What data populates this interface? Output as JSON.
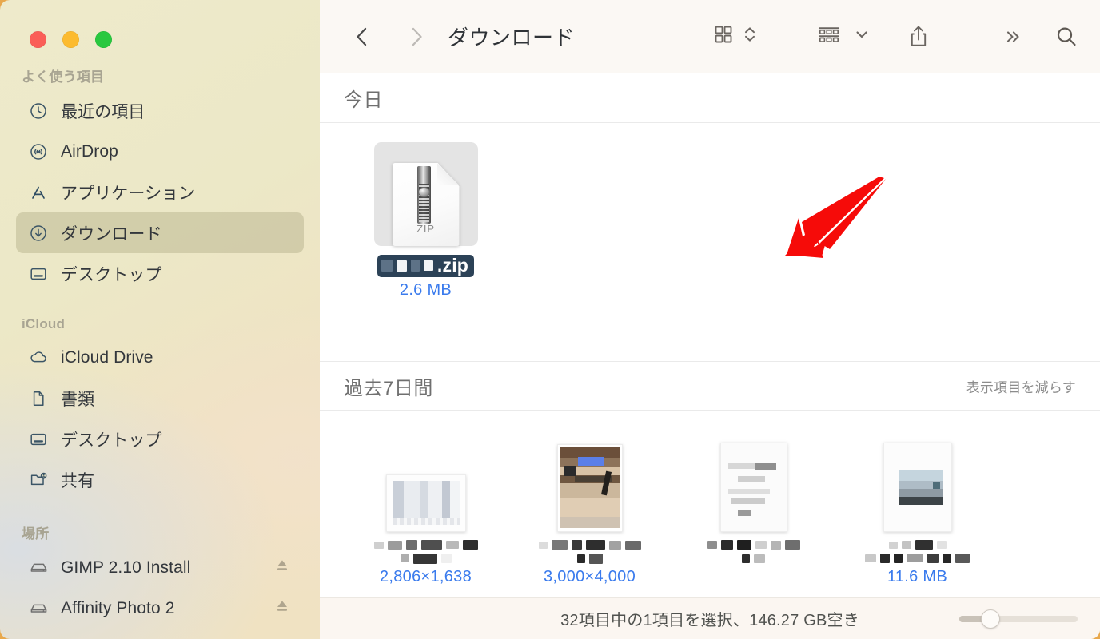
{
  "window": {
    "traffic_lights": [
      {
        "name": "close",
        "color": "#fa5e57"
      },
      {
        "name": "minimize",
        "color": "#fcbb2f"
      },
      {
        "name": "zoom",
        "color": "#29c83f"
      }
    ]
  },
  "toolbar": {
    "back_icon": "chevron-left-icon",
    "forward_icon": "chevron-right-icon",
    "title": "ダウンロード",
    "icon_view": "grid-view-icon",
    "view_stepper": "up-down-chevrons-icon",
    "group_by": "group-by-icon",
    "group_by_chevron": "chevron-down-icon",
    "share": "share-icon",
    "more": "double-chevron-right-icon",
    "search": "search-icon"
  },
  "groups": [
    {
      "title": "今日",
      "action": "",
      "items": [
        {
          "kind": "zip",
          "selected": true,
          "icon": "zip-archive-icon",
          "icon_text": "ZIP",
          "name_extension": ".zip",
          "name_redacted": true,
          "meta": "2.6 MB"
        }
      ]
    },
    {
      "title": "過去7日間",
      "action": "表示項目を減らす",
      "items": [
        {
          "kind": "image",
          "selected": false,
          "icon": "image-thumbnail",
          "name_redacted": true,
          "meta": "2,806×1,638"
        },
        {
          "kind": "image",
          "selected": false,
          "icon": "photo-thumbnail",
          "name_redacted": true,
          "meta": "3,000×4,000"
        },
        {
          "kind": "document",
          "selected": false,
          "icon": "document-thumbnail",
          "name_redacted": true,
          "meta": ""
        },
        {
          "kind": "image",
          "selected": false,
          "icon": "photo-thumbnail",
          "name_redacted": true,
          "meta": "11.6 MB"
        }
      ]
    }
  ],
  "sidebar": {
    "sections": [
      {
        "header": "よく使う項目",
        "items": [
          {
            "label": "最近の項目",
            "icon": "clock-icon",
            "selected": false,
            "eject": false
          },
          {
            "label": "AirDrop",
            "icon": "airdrop-icon",
            "selected": false,
            "eject": false
          },
          {
            "label": "アプリケーション",
            "icon": "applications-icon",
            "selected": false,
            "eject": false
          },
          {
            "label": "ダウンロード",
            "icon": "downloads-icon",
            "selected": true,
            "eject": false
          },
          {
            "label": "デスクトップ",
            "icon": "desktop-icon",
            "selected": false,
            "eject": false
          }
        ]
      },
      {
        "header": "iCloud",
        "items": [
          {
            "label": "iCloud Drive",
            "icon": "cloud-icon",
            "selected": false,
            "eject": false
          },
          {
            "label": "書類",
            "icon": "document-icon",
            "selected": false,
            "eject": false
          },
          {
            "label": "デスクトップ",
            "icon": "desktop-icon",
            "selected": false,
            "eject": false
          },
          {
            "label": "共有",
            "icon": "shared-folder-icon",
            "selected": false,
            "eject": false
          }
        ]
      },
      {
        "header": "場所",
        "items": [
          {
            "label": "GIMP 2.10 Install",
            "icon": "disk-icon",
            "selected": false,
            "eject": true
          },
          {
            "label": "Affinity Photo 2",
            "icon": "disk-icon",
            "selected": false,
            "eject": true
          }
        ]
      }
    ]
  },
  "statusbar": {
    "text": "32項目中の1項目を選択、146.27 GB空き",
    "zoom_value": 18
  },
  "annotation": {
    "arrow_color": "#f60b09",
    "arrow_name": "red-pointer-arrow"
  },
  "colors": {
    "accent_blue": "#3a7bed",
    "selection_label": "#2c4257",
    "sidebar_selected": "#afaa82"
  }
}
